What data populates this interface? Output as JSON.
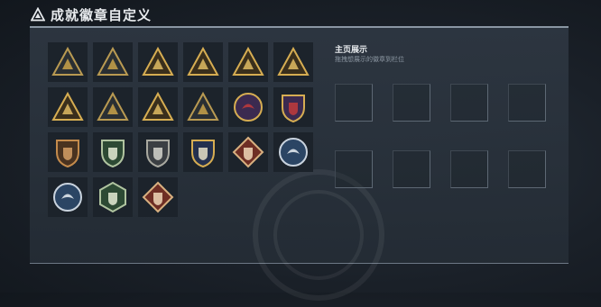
{
  "header": {
    "title": "成就徽章自定义",
    "logo_icon": "triangle-logo-icon"
  },
  "badges": [
    {
      "icon": "mountain-triangle-badge-icon",
      "shape": "tri",
      "style": "dark"
    },
    {
      "icon": "tank-badge-icon",
      "shape": "tri",
      "style": "dark"
    },
    {
      "icon": "eagle-triangle-badge-icon",
      "shape": "tri",
      "style": "gold"
    },
    {
      "icon": "fist-triangle-badge-icon",
      "shape": "tri",
      "style": "gold"
    },
    {
      "icon": "soldier-triangle-badge-icon",
      "shape": "tri",
      "style": "gold"
    },
    {
      "icon": "vehicle-triangle-badge-icon",
      "shape": "tri",
      "style": "gold"
    },
    {
      "icon": "book-triangle-badge-icon",
      "shape": "tri",
      "style": "gold"
    },
    {
      "icon": "helmet-triangle-badge-icon",
      "shape": "tri",
      "style": "dark"
    },
    {
      "icon": "number-one-badge-icon",
      "shape": "tri",
      "style": "gold"
    },
    {
      "icon": "horse-triangle-badge-icon",
      "shape": "tri",
      "style": "dark"
    },
    {
      "icon": "cross-emblem-badge-icon",
      "shape": "circle",
      "style": "colorful"
    },
    {
      "icon": "star-shield-badge-icon",
      "shape": "shield",
      "style": "colorful"
    },
    {
      "icon": "lion-shield-badge-icon",
      "shape": "shield",
      "style": "bronze"
    },
    {
      "icon": "wolf-green-shield-badge-icon",
      "shape": "shield",
      "style": "green"
    },
    {
      "icon": "dagger-shield-badge-icon",
      "shape": "shield",
      "style": "gray"
    },
    {
      "icon": "eagle-shield-badge-icon",
      "shape": "shield",
      "style": "navy"
    },
    {
      "icon": "dragon-diamond-badge-icon",
      "shape": "diamond",
      "style": "red"
    },
    {
      "icon": "wolf-circle-badge-icon",
      "shape": "circle",
      "style": "blue"
    },
    {
      "icon": "wolf-blue-circle-badge-icon",
      "shape": "circle",
      "style": "blue"
    },
    {
      "icon": "eagle-hexagon-badge-icon",
      "shape": "hex",
      "style": "green"
    },
    {
      "icon": "dragon-diamond-badge-icon-2",
      "shape": "diamond",
      "style": "red"
    }
  ],
  "showcase": {
    "title": "主页展示",
    "subtitle": "拖拽想展示的徽章到栏位",
    "slot_count": 8
  },
  "colors": {
    "accent_gold": "#c9a24a",
    "panel_border": "#8a96a3"
  }
}
